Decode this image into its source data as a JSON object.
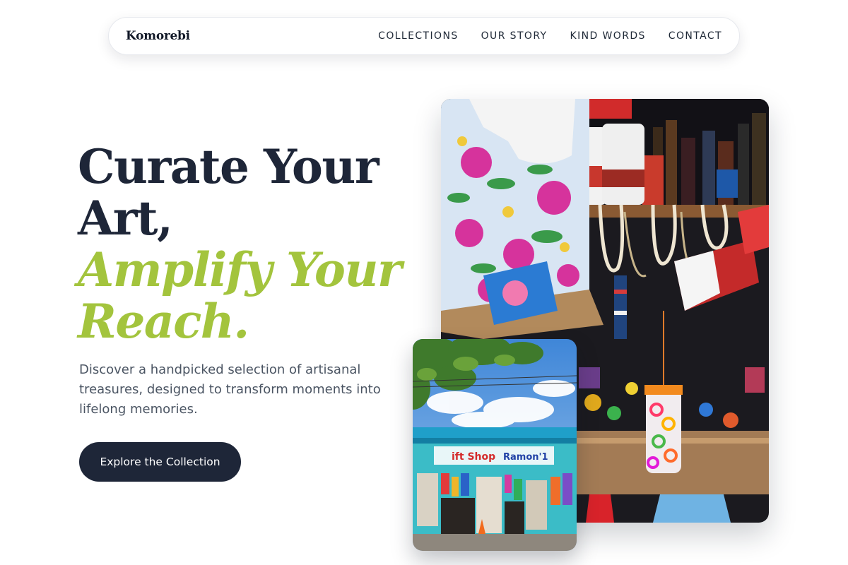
{
  "brand": {
    "name": "Komorebi"
  },
  "nav": {
    "links": [
      "COLLECTIONS",
      "OUR STORY",
      "KIND WORDS",
      "CONTACT"
    ]
  },
  "hero": {
    "title_line1": "Curate Your",
    "title_line2": "Art,",
    "title_line3": "Amplify Your",
    "title_line4": "Reach.",
    "description": "Discover a handpicked selection of artisanal treasures, designed to transform moments into lifelong memories.",
    "cta_label": "Explore the Collection"
  },
  "images": {
    "main_alt": "Market stall with souvenirs, flags and colorful fabrics",
    "small_alt": "Gift Shop storefront under blue sky",
    "small_sign_1": "ift Shop",
    "small_sign_2": "Ramon'1"
  },
  "colors": {
    "primary": "#1e2638",
    "accent": "#a3c43d",
    "text_muted": "#4b5563"
  }
}
